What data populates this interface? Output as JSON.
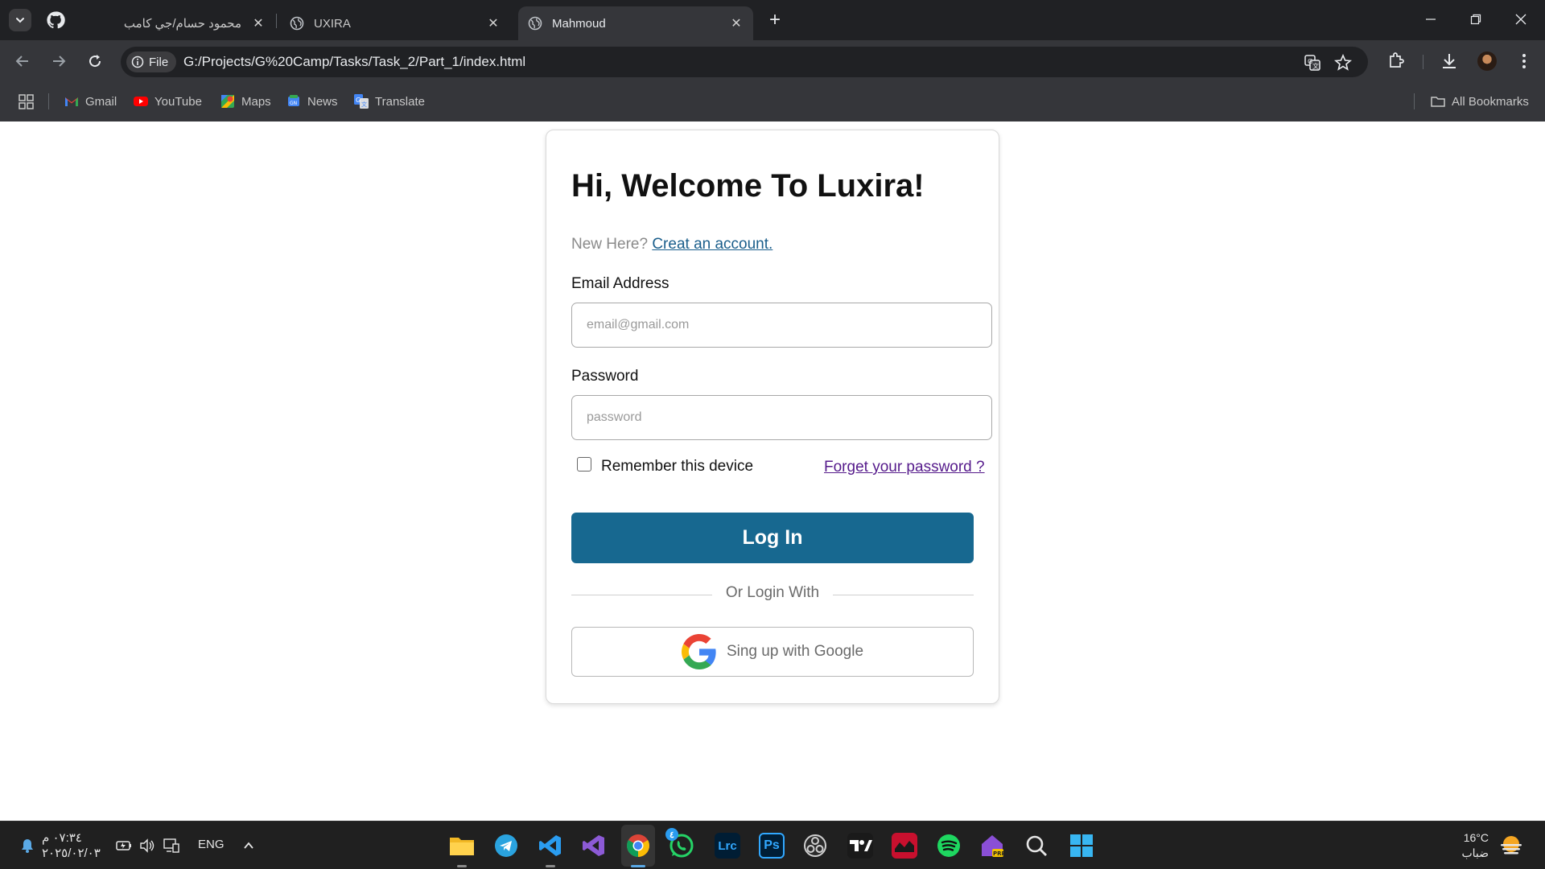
{
  "browser": {
    "tabs": [
      {
        "title": "محمود حسام/جي كامب",
        "close": "✕"
      },
      {
        "title": "UXIRA",
        "close": "✕"
      },
      {
        "title": "Mahmoud",
        "close": "✕",
        "active": true
      }
    ],
    "new_tab": "+",
    "address_chip": "File",
    "url": "G:/Projects/G%20Camp/Tasks/Task_2/Part_1/index.html",
    "bookmarks": [
      "Gmail",
      "YouTube",
      "Maps",
      "News",
      "Translate"
    ],
    "all_bookmarks": "All Bookmarks"
  },
  "login": {
    "heading": "Hi, Welcome To Luxira!",
    "new_here": "New Here?",
    "create_link": "Creat an account.",
    "email_label": "Email Address",
    "email_placeholder": "email@gmail.com",
    "password_label": "Password",
    "password_placeholder": "password",
    "remember_label": "Remember this device",
    "forgot_link": "Forget your password ?",
    "login_button": "Log In",
    "divider_text": "Or Login With",
    "google_button": "Sing up with Google",
    "accent_color": "#176890"
  },
  "taskbar": {
    "time": "٠٧:٣٤ م",
    "date": "٢٠٢٥/٠٢/٠٣",
    "language": "ENG",
    "weather_temp": "16°C",
    "weather_desc": "ضباب",
    "apps": [
      "file-explorer",
      "telegram",
      "vscode",
      "visual-studio",
      "chrome",
      "whatsapp",
      "lightroom-classic",
      "photoshop",
      "obs",
      "tradingview",
      "anydesk",
      "spotify",
      "notion-pre",
      "search",
      "start"
    ],
    "whatsapp_badge": "٤"
  }
}
